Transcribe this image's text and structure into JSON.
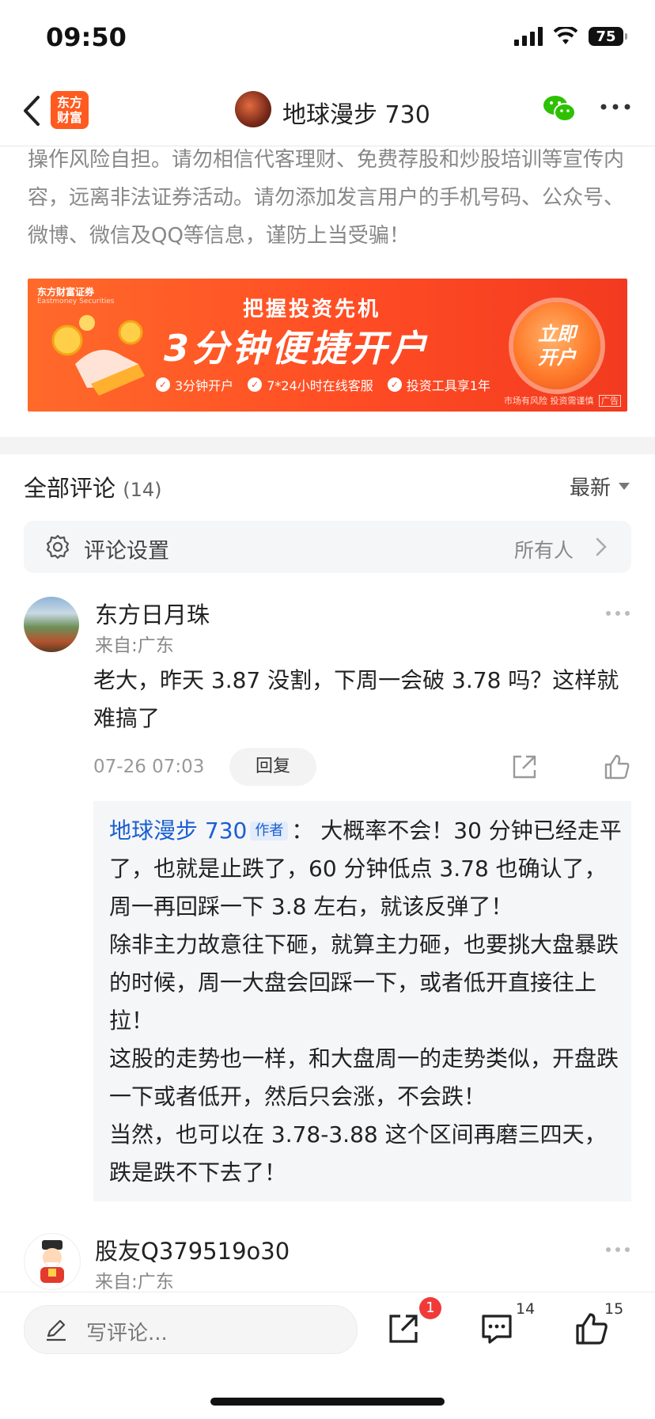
{
  "status_bar": {
    "time": "09:50",
    "battery": "75"
  },
  "nav": {
    "logo_line1": "东方",
    "logo_line2": "财富",
    "title": "地球漫步 730"
  },
  "disclaimer": {
    "text": "操作风险自担。请勿相信代客理财、免费荐股和炒股培训等宣传内容，远离非法证券活动。请勿添加发言用户的手机号码、公众号、微博、微信及QQ等信息，谨防上当受骗！"
  },
  "ad": {
    "brand": "东方财富证券",
    "brand_en": "Eastmoney Securities",
    "headline": "把握投资先机",
    "big": "3分钟便捷开户",
    "features": [
      "3分钟开户",
      "7*24小时在线客服",
      "投资工具享1年"
    ],
    "cta_line1": "立即",
    "cta_line2": "开户",
    "risk": "市场有风险 投资需谨慎",
    "ad_tag": "广告"
  },
  "comments_header": {
    "title": "全部评论",
    "count": "(14)",
    "sort": "最新"
  },
  "comment_settings": {
    "label": "评论设置",
    "value": "所有人"
  },
  "comments": [
    {
      "user": "东方日月珠",
      "location": "来自:广东",
      "text": "老大，昨天 3.87 没割，下周一会破 3.78 吗？这样就难搞了",
      "time": "07-26 07:03",
      "reply_label": "回复",
      "reply": {
        "author": "地球漫步 730",
        "tag": "作者",
        "sep": "：",
        "text": "大概率不会！30 分钟已经走平了，也就是止跌了，60 分钟低点 3.78 也确认了，周一再回踩一下 3.8 左右，就该反弹了！",
        "lines": [
          "除非主力故意往下砸，就算主力砸，也要挑大盘暴跌的时候，周一大盘会回踩一下，或者低开直接往上拉！",
          "这股的走势也一样，和大盘周一的走势类似，开盘跌一下或者低开，然后只会涨，不会跌！",
          "当然，也可以在 3.78-3.88 这个区间再磨三四天，跌是跌不下去了！"
        ]
      }
    },
    {
      "user": "股友Q379519o30",
      "location": "来自:广东"
    }
  ],
  "bottom_bar": {
    "placeholder": "写评论...",
    "share_badge": "1",
    "comment_count": "14",
    "like_count": "15"
  },
  "colors": {
    "brand": "#ff5a1f",
    "link": "#1a5fd0",
    "badge": "#f03a3a"
  }
}
